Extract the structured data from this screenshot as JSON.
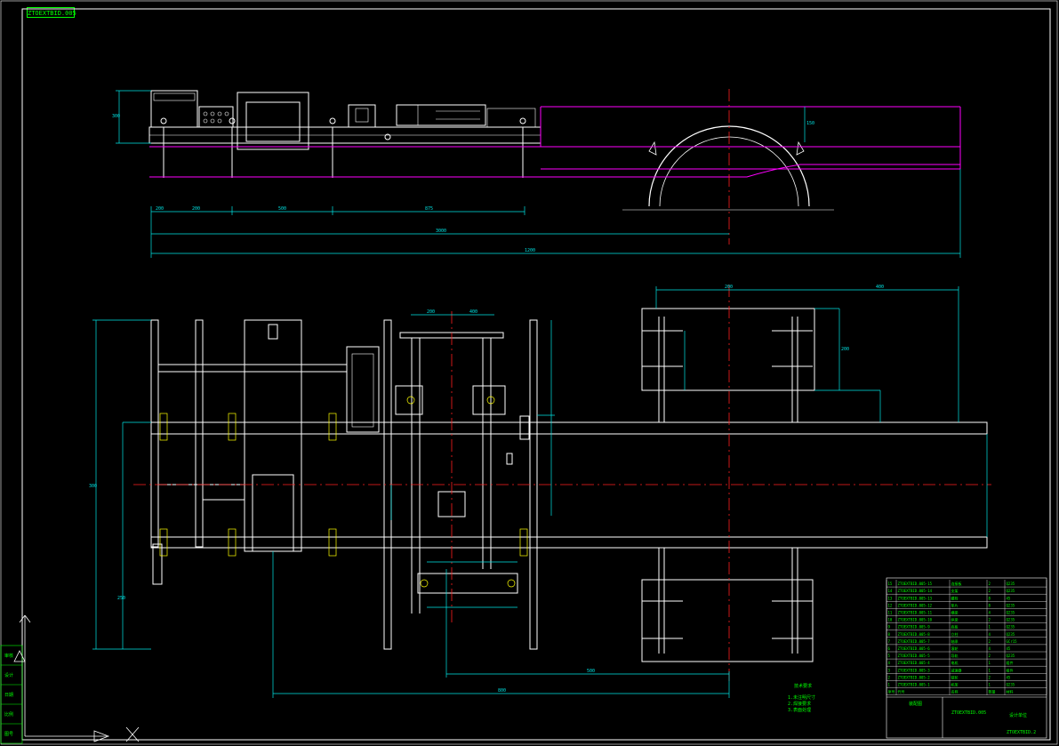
{
  "drawing": {
    "tag": "ZTOEXTBID.005",
    "scale_x": "1:10",
    "dims_side": [
      "300",
      "200",
      "500",
      "875",
      "3000",
      "1200",
      "200",
      "150"
    ],
    "dims_plan": [
      "300",
      "200",
      "400",
      "200",
      "400",
      "500",
      "800",
      "200",
      "250"
    ],
    "notes_title": "技术要求",
    "notes": [
      "1.未注明尺寸",
      "2.焊接要求",
      "3.表面处理"
    ],
    "title_block": {
      "drawing_title": "装配图",
      "drawing_no": "ZTOEXTBID.005",
      "company": "设计单位",
      "sheet": "ZTOEXTBID.2",
      "rows": [
        {
          "no": "15",
          "code": "ZTOEXTBID.005-15",
          "name": "连接板",
          "qty": "2",
          "mat": "Q235"
        },
        {
          "no": "14",
          "code": "ZTOEXTBID.005-14",
          "name": "支架",
          "qty": "2",
          "mat": "Q235"
        },
        {
          "no": "13",
          "code": "ZTOEXTBID.005-13",
          "name": "螺栓",
          "qty": "8",
          "mat": "45"
        },
        {
          "no": "12",
          "code": "ZTOEXTBID.005-12",
          "name": "垫片",
          "qty": "8",
          "mat": "Q235"
        },
        {
          "no": "11",
          "code": "ZTOEXTBID.005-11",
          "name": "横梁",
          "qty": "4",
          "mat": "Q235"
        },
        {
          "no": "10",
          "code": "ZTOEXTBID.005-10",
          "name": "纵梁",
          "qty": "2",
          "mat": "Q235"
        },
        {
          "no": "9",
          "code": "ZTOEXTBID.005-9",
          "name": "底板",
          "qty": "1",
          "mat": "Q235"
        },
        {
          "no": "8",
          "code": "ZTOEXTBID.005-8",
          "name": "立柱",
          "qty": "4",
          "mat": "Q235"
        },
        {
          "no": "7",
          "code": "ZTOEXTBID.005-7",
          "name": "轴承",
          "qty": "2",
          "mat": "GCr15"
        },
        {
          "no": "6",
          "code": "ZTOEXTBID.005-6",
          "name": "滚轮",
          "qty": "4",
          "mat": "45"
        },
        {
          "no": "5",
          "code": "ZTOEXTBID.005-5",
          "name": "导轨",
          "qty": "2",
          "mat": "Q235"
        },
        {
          "no": "4",
          "code": "ZTOEXTBID.005-4",
          "name": "电机",
          "qty": "1",
          "mat": "组件"
        },
        {
          "no": "3",
          "code": "ZTOEXTBID.005-3",
          "name": "减速器",
          "qty": "1",
          "mat": "组件"
        },
        {
          "no": "2",
          "code": "ZTOEXTBID.005-2",
          "name": "链轮",
          "qty": "2",
          "mat": "45"
        },
        {
          "no": "1",
          "code": "ZTOEXTBID.005-1",
          "name": "机架",
          "qty": "1",
          "mat": "Q235"
        }
      ],
      "header": [
        "序号",
        "代号",
        "名称",
        "数量",
        "材料"
      ]
    },
    "left_panel": [
      "审核",
      "设计",
      "日期",
      "比例",
      "图号"
    ]
  },
  "colors": {
    "white": "#ffffff",
    "cyan": "#00e5e5",
    "red": "#ff2020",
    "magenta": "#ff00ff",
    "green": "#00ff00",
    "yellow": "#ffff00"
  }
}
